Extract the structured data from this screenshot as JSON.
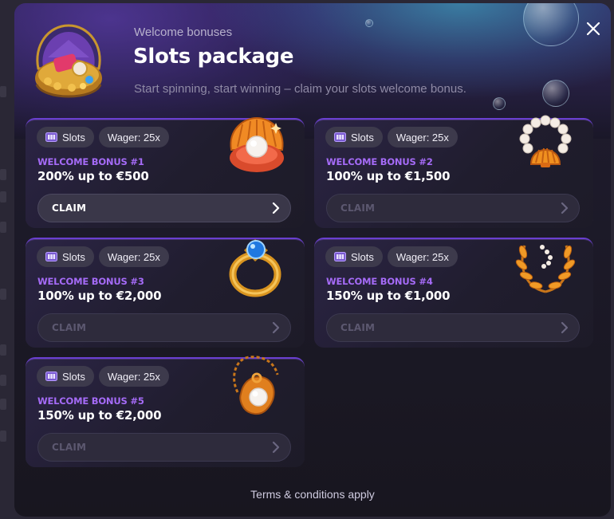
{
  "modal": {
    "subtitle": "Welcome bonuses",
    "title": "Slots package",
    "description": "Start spinning, start winning – claim your slots welcome bonus.",
    "close_icon": "close-icon",
    "hero_icon": "treasure-chest-icon"
  },
  "bonuses": [
    {
      "tag": "Slots",
      "wager": "Wager: 25x",
      "label": "WELCOME BONUS #1",
      "amount": "200% up to €500",
      "claim": "CLAIM",
      "art": "pearl-shell-icon",
      "active": true
    },
    {
      "tag": "Slots",
      "wager": "Wager: 25x",
      "label": "WELCOME BONUS #2",
      "amount": "100% up to €1,500",
      "claim": "CLAIM",
      "art": "pearl-necklace-icon",
      "active": false
    },
    {
      "tag": "Slots",
      "wager": "Wager: 25x",
      "label": "WELCOME BONUS #3",
      "amount": "100% up to €2,000",
      "claim": "CLAIM",
      "art": "sapphire-ring-icon",
      "active": false
    },
    {
      "tag": "Slots",
      "wager": "Wager: 25x",
      "label": "WELCOME BONUS #4",
      "amount": "150% up to €1,000",
      "claim": "CLAIM",
      "art": "laurel-wreath-icon",
      "active": false
    },
    {
      "tag": "Slots",
      "wager": "Wager: 25x",
      "label": "WELCOME BONUS #5",
      "amount": "150% up to €2,000",
      "claim": "CLAIM",
      "art": "pearl-pendant-icon",
      "active": false
    }
  ],
  "footer": {
    "terms": "Terms & conditions apply"
  },
  "colors": {
    "accent_purple": "#a56bf7",
    "card_border": "#6a3fd0",
    "pill_bg": "#3d3a4c"
  }
}
